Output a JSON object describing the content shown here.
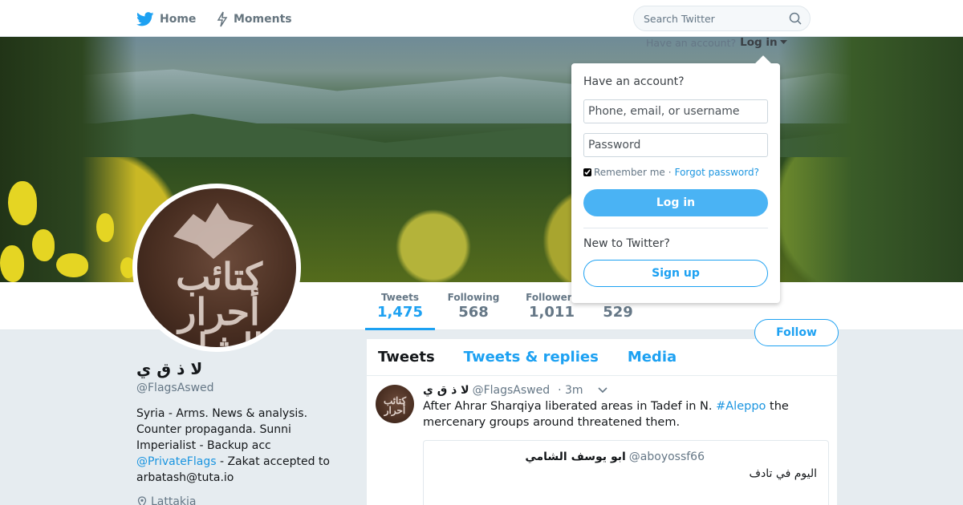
{
  "topbar": {
    "home_label": "Home",
    "moments_label": "Moments",
    "search_placeholder": "Search Twitter"
  },
  "login": {
    "prompt": "Have an account?",
    "trigger_label": "Log in",
    "panel_title": "Have an account?",
    "username_placeholder": "Phone, email, or username",
    "password_placeholder": "Password",
    "remember_label": "Remember me",
    "separator": "·",
    "forgot_label": "Forgot password?",
    "login_button": "Log in",
    "new_label": "New to Twitter?",
    "signup_button": "Sign up"
  },
  "stats": {
    "tweets_label": "Tweets",
    "tweets_value": "1,475",
    "following_label": "Following",
    "following_value": "568",
    "followers_label": "Followers",
    "followers_value": "1,011",
    "likes_value": "529"
  },
  "profile": {
    "name": "لا ذ ق ي",
    "handle": "@FlagsAswed",
    "bio_text": "Syria - Arms. News & analysis. Counter propaganda. Sunni Imperialist - Backup acc",
    "bio_link": "@PrivateFlags",
    "bio_tail": "- Zakat accepted to arbatash@tuta.io",
    "location": "Lattakia",
    "follow_button": "Follow",
    "avatar_text": "كتائب أحرار الشام"
  },
  "timeline": {
    "tabs": [
      "Tweets",
      "Tweets & replies",
      "Media"
    ]
  },
  "tweet": {
    "name": "لا ذ ق ي",
    "handle": "@FlagsAswed",
    "time": "· 3m",
    "text_before": "After Ahrar Sharqiya liberated areas in Tadef in N.",
    "hashtag": "#Aleppo",
    "text_after": "the mercenary groups around threatened them.",
    "avatar_text": "كتائب أحرار"
  },
  "quote": {
    "name": "ابو يوسف الشامي",
    "handle": "@aboyossf66",
    "text": "اليوم في تادف"
  },
  "colors": {
    "accent": "#1da1f2",
    "link": "#1b95e0",
    "page_bg": "#e6ecf0"
  }
}
